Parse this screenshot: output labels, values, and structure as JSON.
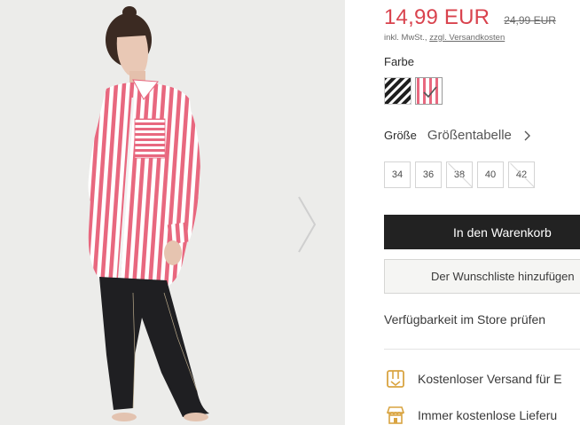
{
  "product": {
    "price_current": "14,99 EUR",
    "price_old": "24,99 EUR",
    "tax_note": "inkl. MwSt.,",
    "shipping_link": "zzgl. Versandkosten"
  },
  "color": {
    "label": "Farbe",
    "options": [
      {
        "icon": "black-white-stripe-swatch",
        "selected": false
      },
      {
        "icon": "pink-white-stripe-swatch",
        "selected": true
      }
    ]
  },
  "size": {
    "label": "Größe",
    "table_link": "Größentabelle",
    "options": [
      {
        "label": "34",
        "available": true
      },
      {
        "label": "36",
        "available": true
      },
      {
        "label": "38",
        "available": false
      },
      {
        "label": "40",
        "available": true
      },
      {
        "label": "42",
        "available": false
      }
    ]
  },
  "actions": {
    "add_to_cart": "In den Warenkorb",
    "wishlist": "Der Wunschliste hinzufügen",
    "store_check": "Verfügbarkeit im Store prüfen"
  },
  "benefits": [
    {
      "icon": "box-shipping-icon",
      "text": "Kostenloser Versand für E"
    },
    {
      "icon": "store-icon",
      "text": "Immer kostenlose Lieferu"
    }
  ],
  "colors": {
    "price_red": "#d9434e",
    "button_dark": "#222222",
    "icon_gold": "#d9a441",
    "stripe_pink": "#e8687f"
  }
}
